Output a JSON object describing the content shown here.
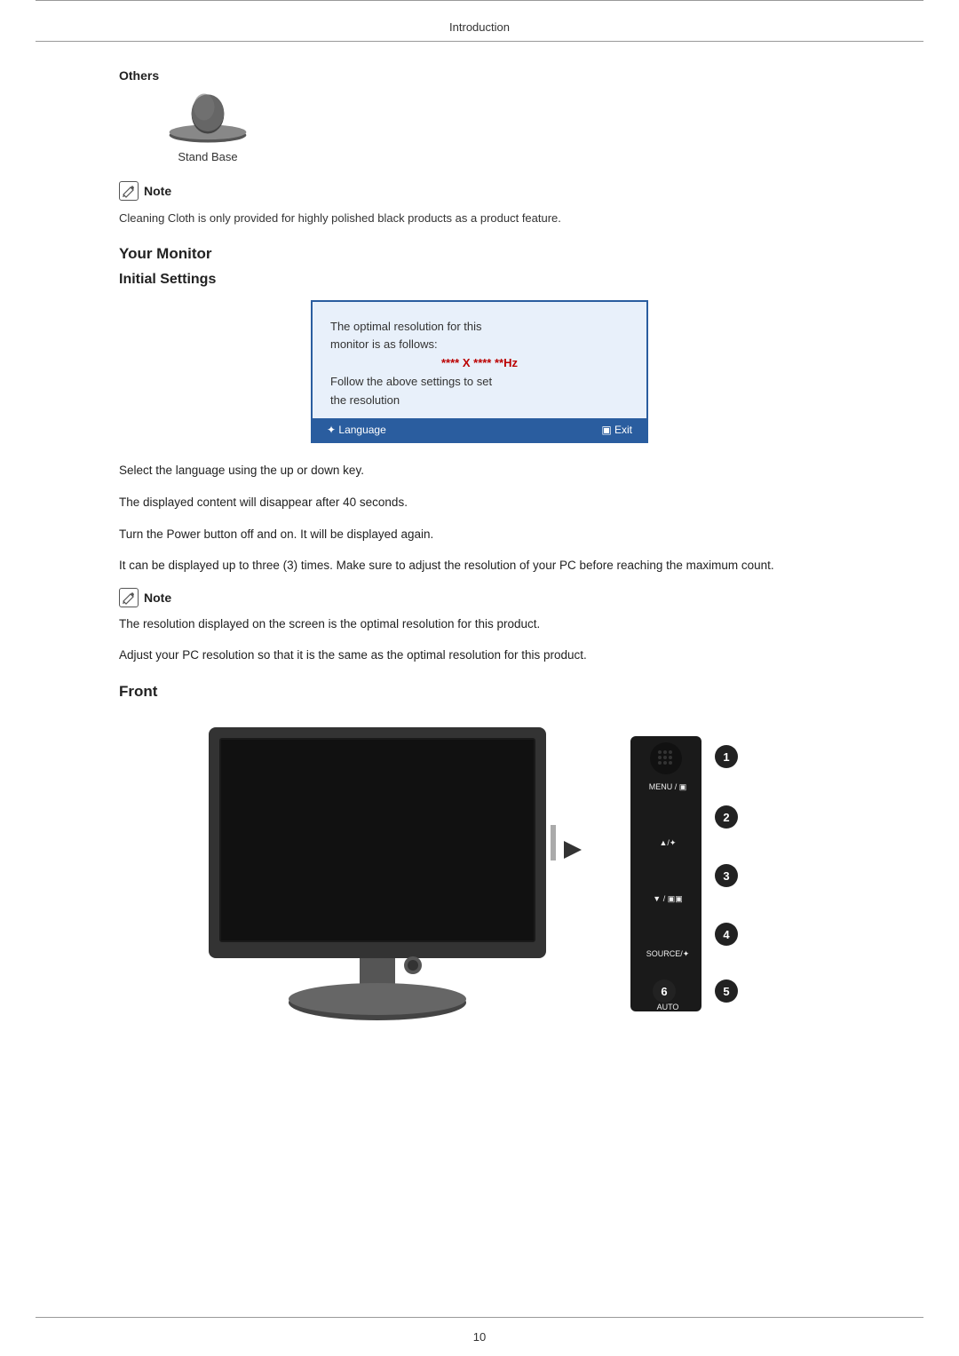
{
  "header": {
    "title": "Introduction"
  },
  "others": {
    "label": "Others",
    "item_label": "Stand Base"
  },
  "note1": {
    "label": "Note",
    "text": "Cleaning Cloth is only provided for highly polished black products as a product feature."
  },
  "your_monitor": {
    "heading": "Your Monitor"
  },
  "initial_settings": {
    "heading": "Initial Settings",
    "dialog": {
      "line1": "The optimal resolution for this",
      "line2": "monitor is as follows:",
      "resolution": "**** X **** **Hz",
      "line3": "Follow the above settings to set",
      "line4": "the resolution",
      "footer_left": "✦ Language",
      "footer_right": "▣ Exit"
    },
    "para1": "Select the language using the up or down key.",
    "para2": "The displayed content will disappear after 40 seconds.",
    "para3": "Turn the Power button off and on. It will be displayed again.",
    "para4": "It can be displayed up to three (3) times. Make sure to adjust the resolution of your PC before reaching the maximum count."
  },
  "note2": {
    "label": "Note",
    "para1": "The resolution displayed on the screen is the optimal resolution for this product.",
    "para2": "Adjust your PC resolution so that it is the same as the optimal resolution for this product."
  },
  "front": {
    "heading": "Front",
    "buttons": [
      {
        "number": "1",
        "label": "MENU / ▣"
      },
      {
        "number": "2",
        "label": ""
      },
      {
        "number": "3",
        "label": "▲/✦"
      },
      {
        "number": "4",
        "label": "▼ / ▣▣"
      },
      {
        "number": "5",
        "label": "SOURCE/✦"
      },
      {
        "number": "6",
        "label": ""
      }
    ],
    "button5_label": "AUTO"
  },
  "page_number": "10"
}
